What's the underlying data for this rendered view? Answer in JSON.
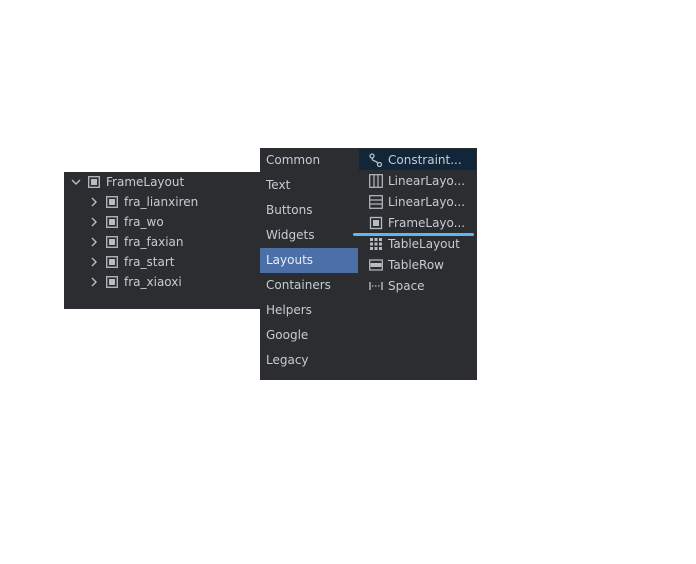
{
  "colors": {
    "panel_bg": "#2b2d30",
    "text": "#c8ccd2",
    "category_selected_bg": "#4d6fa8",
    "widget_selected_bg": "#12263a",
    "drop_indicator": "#62b6ee",
    "icon_stroke": "#b8bcc2"
  },
  "component_tree": {
    "root": {
      "label": "FrameLayout",
      "expanded": true,
      "icon": "frame-layout-icon"
    },
    "children": [
      {
        "label": "fra_lianxiren",
        "icon": "frame-layout-icon"
      },
      {
        "label": "fra_wo",
        "icon": "frame-layout-icon"
      },
      {
        "label": "fra_faxian",
        "icon": "frame-layout-icon"
      },
      {
        "label": "fra_start",
        "icon": "frame-layout-icon"
      },
      {
        "label": "fra_xiaoxi",
        "icon": "frame-layout-icon"
      }
    ]
  },
  "palette": {
    "categories": [
      {
        "label": "Common"
      },
      {
        "label": "Text"
      },
      {
        "label": "Buttons"
      },
      {
        "label": "Widgets"
      },
      {
        "label": "Layouts",
        "selected": true
      },
      {
        "label": "Containers"
      },
      {
        "label": "Helpers"
      },
      {
        "label": "Google"
      },
      {
        "label": "Legacy"
      }
    ],
    "widgets": [
      {
        "label": "Constraint...",
        "icon": "constraint-layout-icon",
        "selected": true
      },
      {
        "label": "LinearLayo...",
        "icon": "linear-layout-horizontal-icon"
      },
      {
        "label": "LinearLayo...",
        "icon": "linear-layout-vertical-icon"
      },
      {
        "label": "FrameLayo...",
        "icon": "frame-layout-icon"
      },
      {
        "label": "TableLayout",
        "icon": "table-layout-icon"
      },
      {
        "label": "TableRow",
        "icon": "table-row-icon"
      },
      {
        "label": "Space",
        "icon": "space-icon"
      }
    ]
  }
}
